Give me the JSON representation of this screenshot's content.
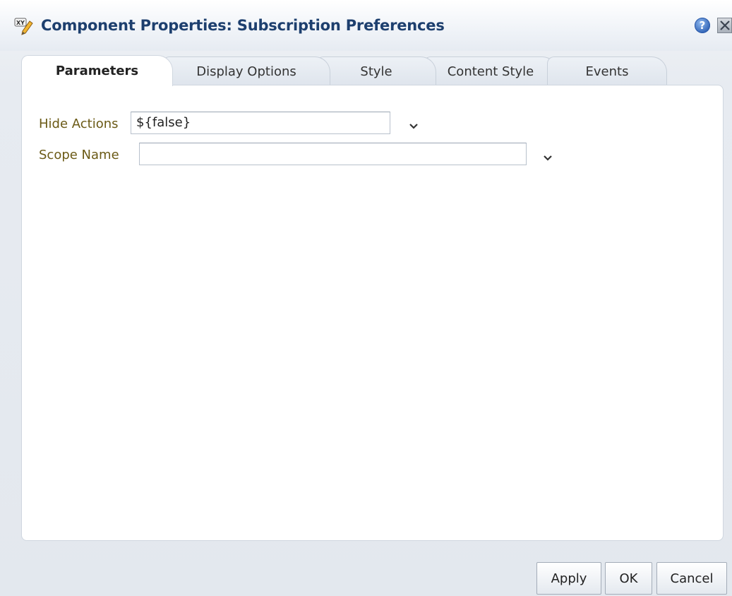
{
  "dialog": {
    "title": "Component Properties: Subscription Preferences",
    "title_icon": "xy-edit-icon",
    "help_label": "?",
    "help_icon": "help-icon",
    "close_icon": "close-icon"
  },
  "tabs": [
    {
      "label": "Parameters",
      "active": true
    },
    {
      "label": "Display Options",
      "active": false
    },
    {
      "label": "Style",
      "active": false
    },
    {
      "label": "Content Style",
      "active": false
    },
    {
      "label": "Events",
      "active": false
    }
  ],
  "fields": [
    {
      "label": "Hide Actions",
      "value": "${false}",
      "dropdown_icon": "chevron-down-icon"
    },
    {
      "label": "Scope Name",
      "value": "",
      "dropdown_icon": "chevron-down-icon"
    }
  ],
  "footer": {
    "apply_label": "Apply",
    "ok_label": "OK",
    "cancel_label": "Cancel"
  },
  "colors": {
    "title": "#1d3f6e",
    "field_label": "#6b5a16"
  }
}
